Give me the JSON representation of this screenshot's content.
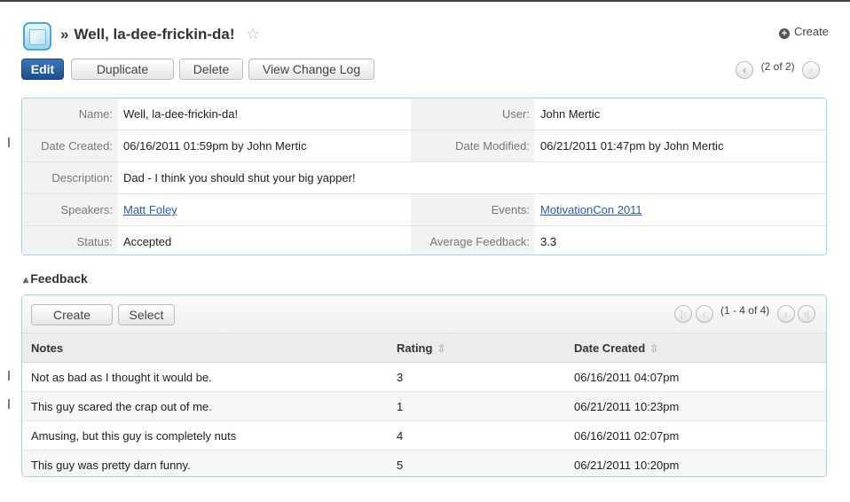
{
  "header": {
    "title": "Well, la-dee-frickin-da!",
    "arrow": "»",
    "create_label": "Create"
  },
  "toolbar": {
    "edit": "Edit",
    "duplicate": "Duplicate",
    "delete": "Delete",
    "view_change_log": "View Change Log",
    "record_position": "(2 of 2)"
  },
  "detail": {
    "name_label": "Name:",
    "name_value": "Well, la-dee-frickin-da!",
    "user_label": "User:",
    "user_value": "John Mertic",
    "date_created_label": "Date Created:",
    "date_created_value": "06/16/2011 01:59pm by John Mertic",
    "date_modified_label": "Date Modified:",
    "date_modified_value": "06/21/2011 01:47pm by John Mertic",
    "description_label": "Description:",
    "description_value": "Dad - I think you should shut your big yapper!",
    "speakers_label": "Speakers:",
    "speakers_value": "Matt Foley",
    "events_label": "Events:",
    "events_value": "MotivationCon 2011",
    "status_label": "Status:",
    "status_value": "Accepted",
    "avg_feedback_label": "Average Feedback:",
    "avg_feedback_value": "3.3"
  },
  "feedback": {
    "title": "Feedback",
    "create": "Create",
    "select": "Select",
    "range": "(1 - 4 of 4)",
    "columns": {
      "notes": "Notes",
      "rating": "Rating",
      "date_created": "Date Created"
    },
    "rows": [
      {
        "notes": "Not as bad as I thought it would be.",
        "rating": "3",
        "date": "06/16/2011 04:07pm"
      },
      {
        "notes": "This guy scared the crap out of me.",
        "rating": "1",
        "date": "06/21/2011 10:23pm"
      },
      {
        "notes": "Amusing, but this guy is completely nuts",
        "rating": "4",
        "date": "06/16/2011 02:07pm"
      },
      {
        "notes": "This guy was pretty darn funny.",
        "rating": "5",
        "date": "06/21/2011 10:20pm"
      }
    ]
  },
  "icons": {
    "module": "module-icon",
    "favorite": "star-icon",
    "create": "plus-circle-icon",
    "collapse": "double-chevron-up-icon",
    "sort": "sort-icon"
  },
  "colors": {
    "primary_button": "#1d4f8c",
    "link": "#2b5ea8",
    "border_accent": "#a9cfe5"
  }
}
